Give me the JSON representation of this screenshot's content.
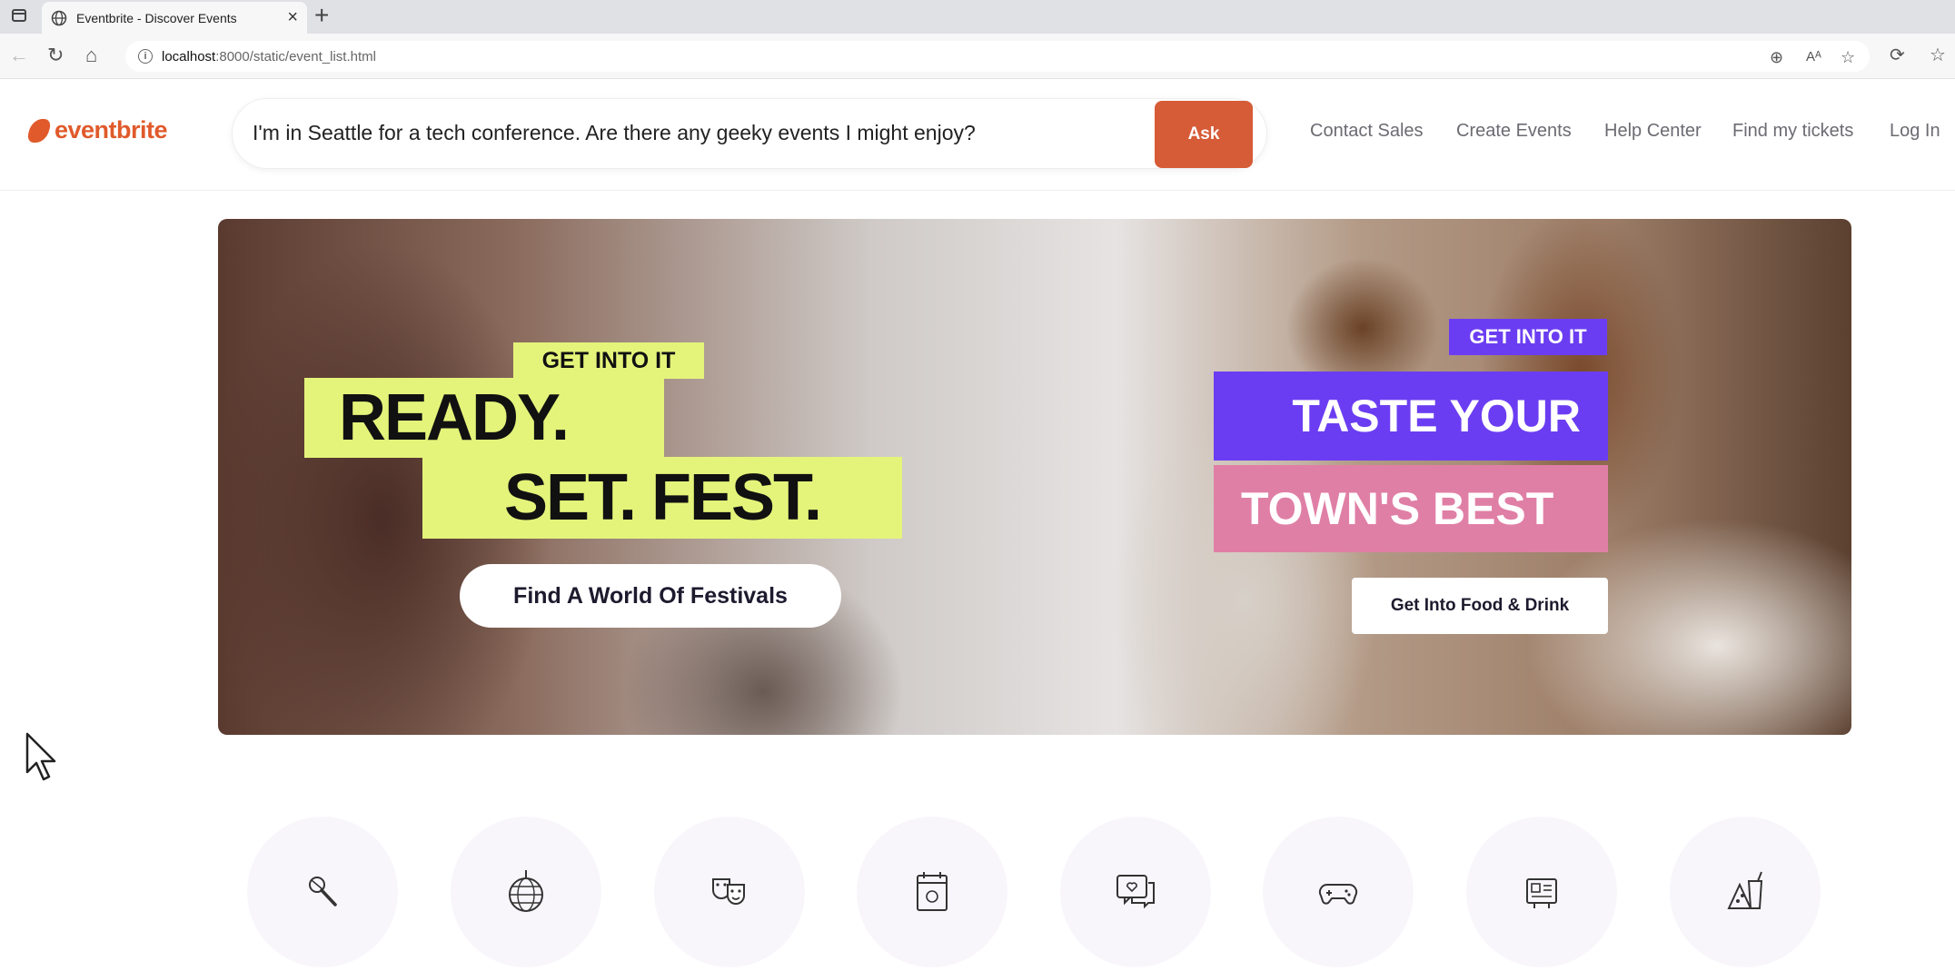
{
  "browser": {
    "tab_title": "Eventbrite - Discover Events",
    "url_host": "localhost",
    "url_path": ":8000/static/event_list.html"
  },
  "header": {
    "logo_text": "eventbrite",
    "search_query": "I'm in Seattle for a tech conference.  Are there any geeky events I might enjoy?",
    "ask_label": "Ask",
    "nav": [
      "Contact Sales",
      "Create Events",
      "Help Center",
      "Find my tickets",
      "Log In"
    ]
  },
  "hero": {
    "left": {
      "tag": "GET INTO IT",
      "line1": "READY.",
      "line2": "SET. FEST.",
      "cta": "Find A World Of Festivals"
    },
    "right": {
      "tag": "GET INTO IT",
      "line1": "TASTE YOUR",
      "line2": "TOWN'S BEST",
      "cta": "Get Into Food & Drink"
    }
  },
  "categories": [
    {
      "icon": "microphone-icon"
    },
    {
      "icon": "disco-ball-icon"
    },
    {
      "icon": "theater-masks-icon"
    },
    {
      "icon": "calendar-icon"
    },
    {
      "icon": "chat-heart-icon"
    },
    {
      "icon": "gamepad-icon"
    },
    {
      "icon": "business-icon"
    },
    {
      "icon": "food-drink-icon"
    }
  ],
  "colors": {
    "brand": "#e05a2b",
    "ask_button": "#d65b37",
    "hero_lime": "#e4f47a",
    "hero_purple": "#6b3df2",
    "hero_pink": "#e07fa6",
    "nav_text": "#6b6b72"
  }
}
